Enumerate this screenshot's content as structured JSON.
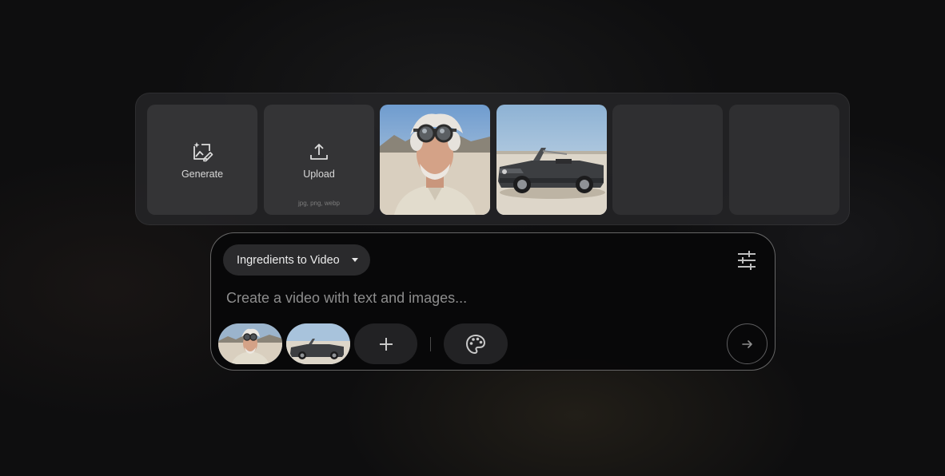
{
  "ingredients": {
    "generate_label": "Generate",
    "upload_label": "Upload",
    "upload_formats": "jpg, png, webp",
    "images": [
      {
        "subject": "elderly man wearing aviator goggles in desert"
      },
      {
        "subject": "dark convertible muscle car in desert"
      }
    ],
    "empty_slots": 2
  },
  "composer": {
    "mode_label": "Ingredients to Video",
    "prompt_placeholder": "Create a video with text and images...",
    "prompt_value": ""
  },
  "icons": {
    "generate": "image-sparkle-edit-icon",
    "upload": "upload-icon",
    "mode_dropdown": "caret-down-icon",
    "settings": "sliders-icon",
    "add": "plus-icon",
    "style": "palette-icon",
    "send": "arrow-right-icon"
  },
  "colors": {
    "background": "#0e0e0f",
    "tray": "#262628",
    "tile": "#343436",
    "composer_border": "#8a8a8a",
    "pill": "#2a2a2c"
  }
}
